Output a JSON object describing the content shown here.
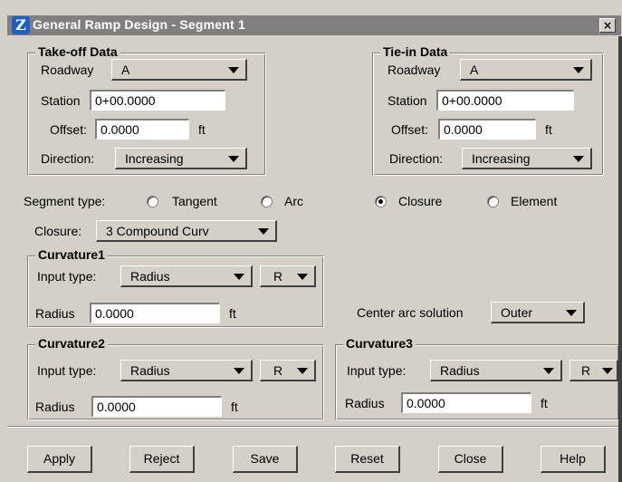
{
  "window": {
    "title": "General Ramp Design - Segment 1",
    "close_symbol": "×",
    "logo_glyph": "Z"
  },
  "takeoff": {
    "group_label": "Take-off Data",
    "roadway_label": "Roadway",
    "roadway_value": "A",
    "station_label": "Station",
    "station_value": "0+00.0000",
    "offset_label": "Offset:",
    "offset_value": "0.0000",
    "offset_unit": "ft",
    "direction_label": "Direction:",
    "direction_value": "Increasing"
  },
  "tiein": {
    "group_label": "Tie-in Data",
    "roadway_label": "Roadway",
    "roadway_value": "A",
    "station_label": "Station",
    "station_value": "0+00.0000",
    "offset_label": "Offset:",
    "offset_value": "0.0000",
    "offset_unit": "ft",
    "direction_label": "Direction:",
    "direction_value": "Increasing"
  },
  "segment": {
    "label": "Segment type:",
    "options": [
      "Tangent",
      "Arc",
      "Closure",
      "Element"
    ],
    "selected": "Closure"
  },
  "closure": {
    "label": "Closure:",
    "value": "3 Compound Curv"
  },
  "curvature1": {
    "group_label": "Curvature1",
    "input_type_label": "Input type:",
    "input_type_value": "Radius",
    "unit_select": "R",
    "radius_label": "Radius",
    "radius_value": "0.0000",
    "radius_unit": "ft"
  },
  "center_arc": {
    "label": "Center arc solution",
    "value": "Outer"
  },
  "curvature2": {
    "group_label": "Curvature2",
    "input_type_label": "Input type:",
    "input_type_value": "Radius",
    "unit_select": "R",
    "radius_label": "Radius",
    "radius_value": "0.0000",
    "radius_unit": "ft"
  },
  "curvature3": {
    "group_label": "Curvature3",
    "input_type_label": "Input type:",
    "input_type_value": "Radius",
    "unit_select": "R",
    "radius_label": "Radius",
    "radius_value": "0.0000",
    "radius_unit": "ft"
  },
  "buttons": {
    "apply": "Apply",
    "reject": "Reject",
    "save": "Save",
    "reset": "Reset",
    "close": "Close",
    "help": "Help"
  }
}
